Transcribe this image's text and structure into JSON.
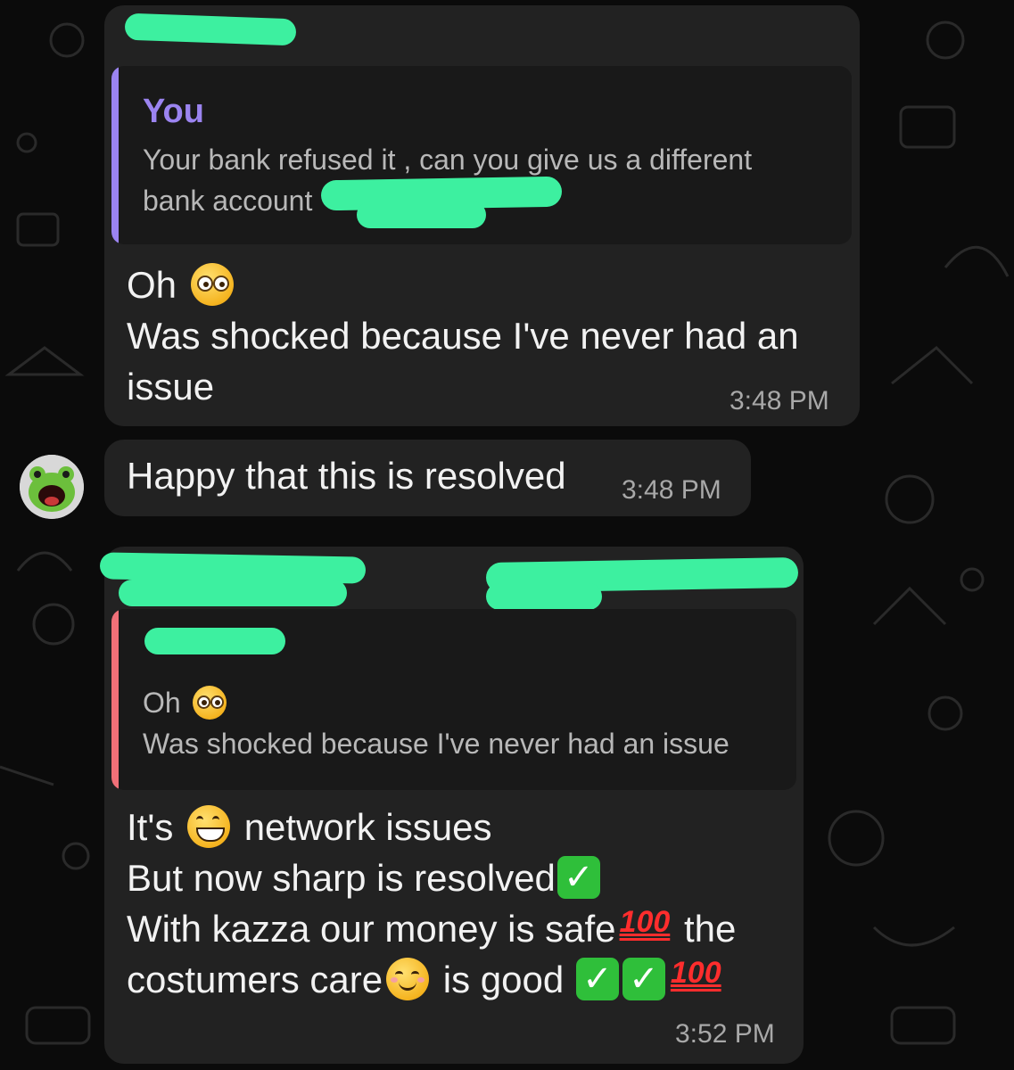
{
  "chat": {
    "messages": [
      {
        "quote_author": "You",
        "quote_text_1": "Your bank refused it , can you give us a different",
        "quote_text_2": "bank account",
        "line1": "Oh",
        "line2": "Was shocked because I've never had an",
        "line3": "issue",
        "time": "3:48 PM"
      },
      {
        "text": "Happy that this is resolved",
        "time": "3:48 PM"
      },
      {
        "quote_line1": "Oh",
        "quote_line2": "Was shocked because I've never had an issue",
        "line1_a": "It's",
        "line1_b": "network issues",
        "line2": "But now sharp is resolved",
        "line3_a": "With kazza our money is safe",
        "line3_b": "the",
        "line4_a": "costumers care",
        "line4_b": "is good",
        "hundred": "100",
        "check": "✓",
        "time": "3:52 PM"
      }
    ]
  },
  "colors": {
    "bubble": "#222222",
    "quote_bar_you": "#9b84f0",
    "quote_bar_other": "#f07078",
    "redaction": "#3df0a0"
  },
  "icons": [
    "flushed-face-emoji",
    "grinning-face-emoji",
    "smiling-face-emoji",
    "check-mark-button-emoji",
    "hundred-points-emoji",
    "frog-avatar"
  ]
}
